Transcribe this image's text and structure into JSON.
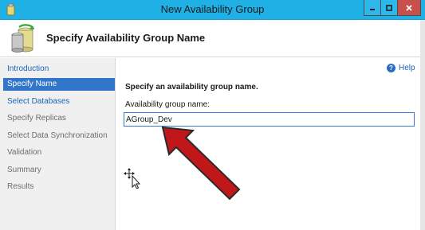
{
  "window": {
    "title": "New Availability Group"
  },
  "header": {
    "title": "Specify Availability Group Name"
  },
  "nav": {
    "items": [
      {
        "label": "Introduction"
      },
      {
        "label": "Specify Name"
      },
      {
        "label": "Select Databases"
      },
      {
        "label": "Specify Replicas"
      },
      {
        "label": "Select Data Synchronization"
      },
      {
        "label": "Validation"
      },
      {
        "label": "Summary"
      },
      {
        "label": "Results"
      }
    ]
  },
  "content": {
    "help_label": "Help",
    "instruction": "Specify an availability group name.",
    "field_label": "Availability group name:",
    "field_value": "AGroup_Dev"
  },
  "colors": {
    "titlebar": "#1fb0e6",
    "nav_active": "#3176c9",
    "link": "#1b63b6",
    "annotation_arrow": "#c0171b"
  },
  "icons": [
    "app-icon",
    "availability-group-icon",
    "minimize-icon",
    "maximize-icon",
    "close-icon",
    "help-icon",
    "move-cursor-icon"
  ]
}
